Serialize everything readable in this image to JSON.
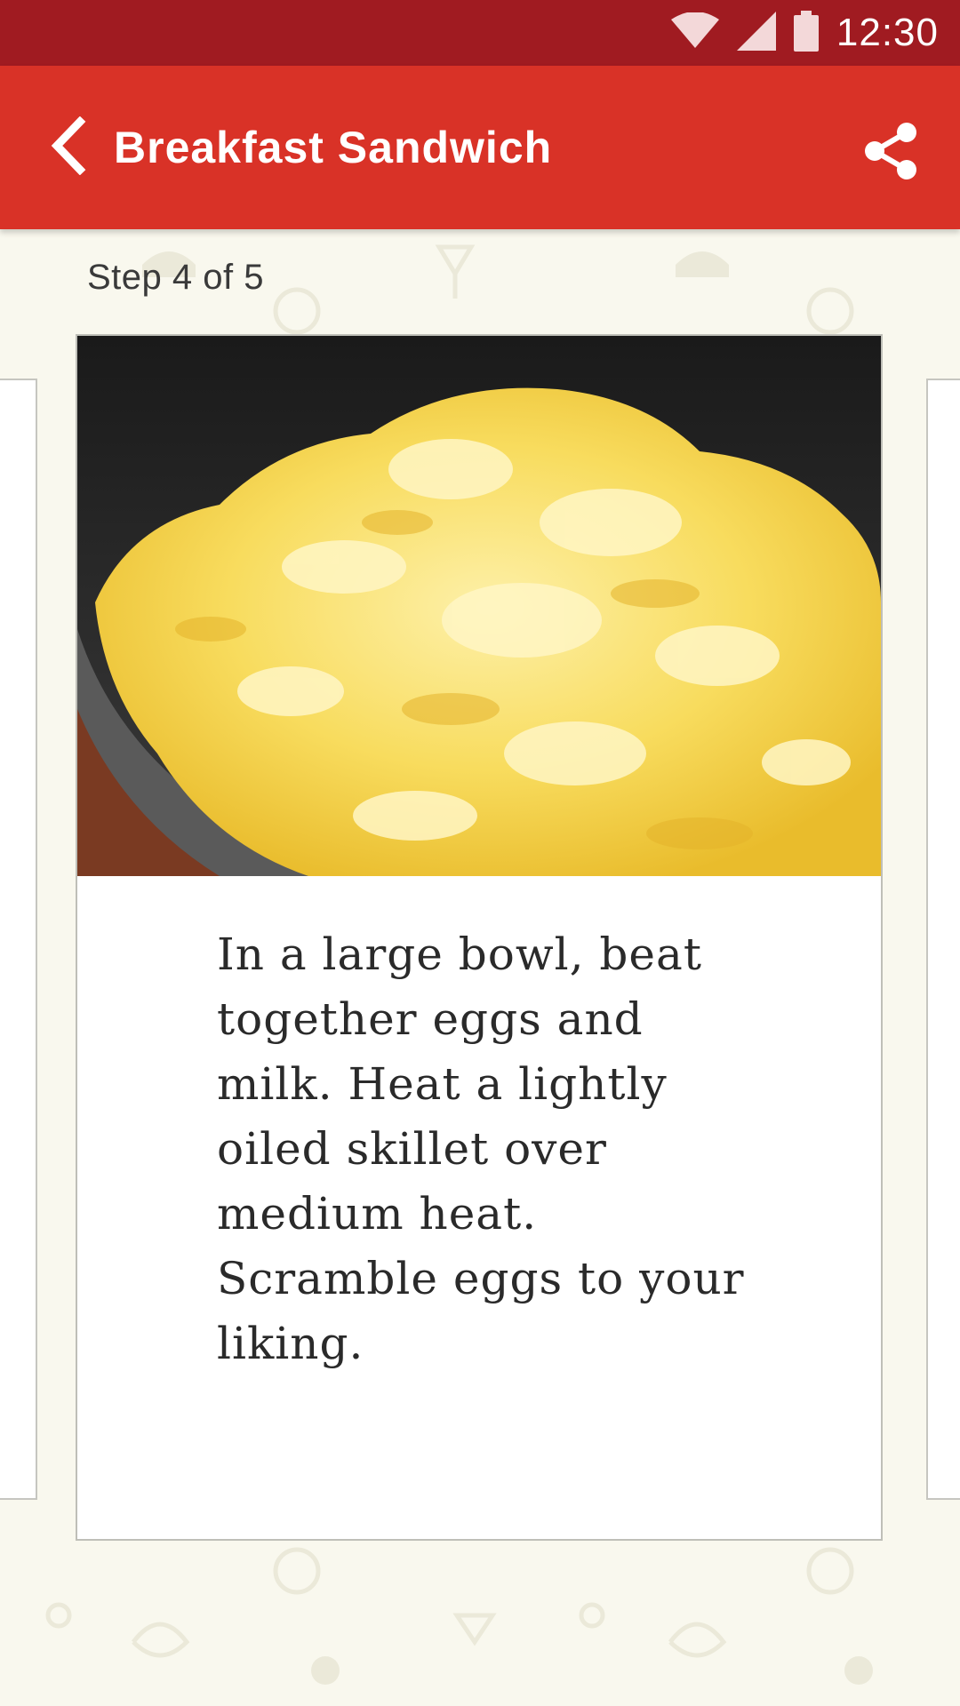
{
  "status_bar": {
    "time": "12:30",
    "icons": [
      "wifi-icon",
      "cellular-signal-icon",
      "battery-icon"
    ]
  },
  "app_bar": {
    "title": "Breakfast Sandwich",
    "back_icon": "chevron-left-icon",
    "share_icon": "share-icon"
  },
  "step": {
    "label": "Step 4 of 5",
    "current": 4,
    "total": 5,
    "image": "scrambled-eggs-in-skillet",
    "instruction": "In a large bowl, beat together eggs and milk. Heat a lightly oiled skillet over medium heat. Scramble eggs to your liking."
  },
  "colors": {
    "status_bar": "#a01b21",
    "app_bar": "#d93227",
    "background": "#f9f8ee",
    "card": "#ffffff"
  }
}
